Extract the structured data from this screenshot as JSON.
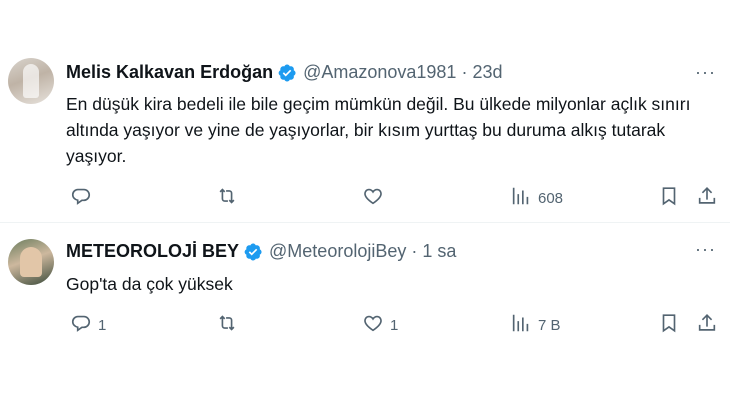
{
  "tweets": [
    {
      "author": "Melis Kalkavan Erdoğan",
      "handle": "@Amazonova1981",
      "separator": "·",
      "time": "23d",
      "text": "En düşük kira bedeli ile bile geçim mümkün değil. Bu ülkede milyonlar açlık sınırı altında yaşıyor ve yine de yaşıyorlar, bir kısım yurttaş bu duruma alkış tutarak yaşıyor.",
      "reply_count": "",
      "retweet_count": "",
      "like_count": "",
      "view_count": "608",
      "more": "···"
    },
    {
      "author": "METEOROLOJİ BEY",
      "handle": "@MeteorolojiBey",
      "separator": "·",
      "time": "1 sa",
      "text": "Gop'ta da çok yüksek",
      "reply_count": "1",
      "retweet_count": "",
      "like_count": "1",
      "view_count": "7 B",
      "more": "···"
    }
  ],
  "colors": {
    "verified": "#1d9bf0",
    "muted": "#536471",
    "text": "#0f1419"
  }
}
